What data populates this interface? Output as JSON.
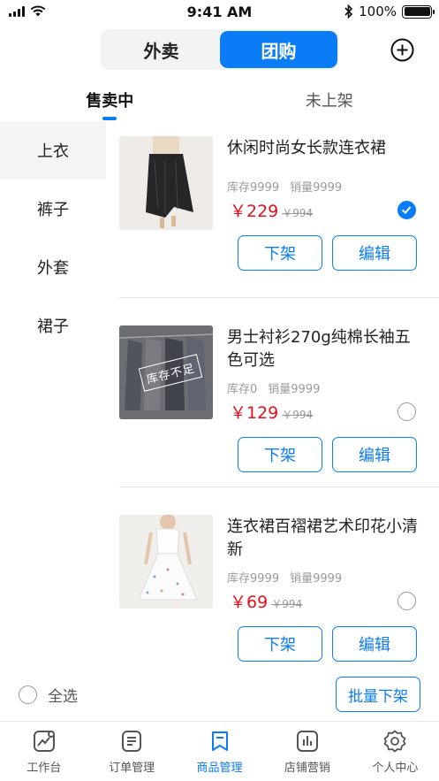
{
  "status_bar": {
    "time": "9:41 AM",
    "battery": "100%"
  },
  "segment": {
    "options": [
      "外卖",
      "团购"
    ],
    "active_index": 1
  },
  "tabs": [
    {
      "label": "售卖中",
      "active": true
    },
    {
      "label": "未上架",
      "active": false
    }
  ],
  "sidebar": {
    "items": [
      {
        "label": "上衣",
        "active": true
      },
      {
        "label": "裤子",
        "active": false
      },
      {
        "label": "外套",
        "active": false
      },
      {
        "label": "裙子",
        "active": false
      }
    ]
  },
  "products": [
    {
      "title": "休闲时尚女长款连衣裙",
      "stock": "库存9999",
      "sales": "销量9999",
      "price": "￥229",
      "old_price": "￥994",
      "checked": true,
      "stamp": ""
    },
    {
      "title": "男士衬衫270g纯棉长袖五色可选",
      "stock": "库存0",
      "sales": "销量9999",
      "price": "￥129",
      "old_price": "￥994",
      "checked": false,
      "stamp": "库存不足"
    },
    {
      "title": "连衣裙百褶裙艺术印花小清新",
      "stock": "库存9999",
      "sales": "销量9999",
      "price": "￥69",
      "old_price": "￥994",
      "checked": false,
      "stamp": ""
    }
  ],
  "card_buttons": {
    "delist": "下架",
    "edit": "编辑"
  },
  "select_bar": {
    "select_all": "全选",
    "batch": "批量下架"
  },
  "tabbar": [
    {
      "label": "工作台",
      "icon": "workbench-icon",
      "active": false
    },
    {
      "label": "订单管理",
      "icon": "order-icon",
      "active": false
    },
    {
      "label": "商品管理",
      "icon": "bookmark-icon",
      "active": true
    },
    {
      "label": "店铺营销",
      "icon": "chart-icon",
      "active": false
    },
    {
      "label": "个人中心",
      "icon": "gear-icon",
      "active": false
    }
  ],
  "colors": {
    "accent": "#0a7cf5",
    "price": "#e3101e",
    "sidebar_active": "#f4f4f4"
  }
}
